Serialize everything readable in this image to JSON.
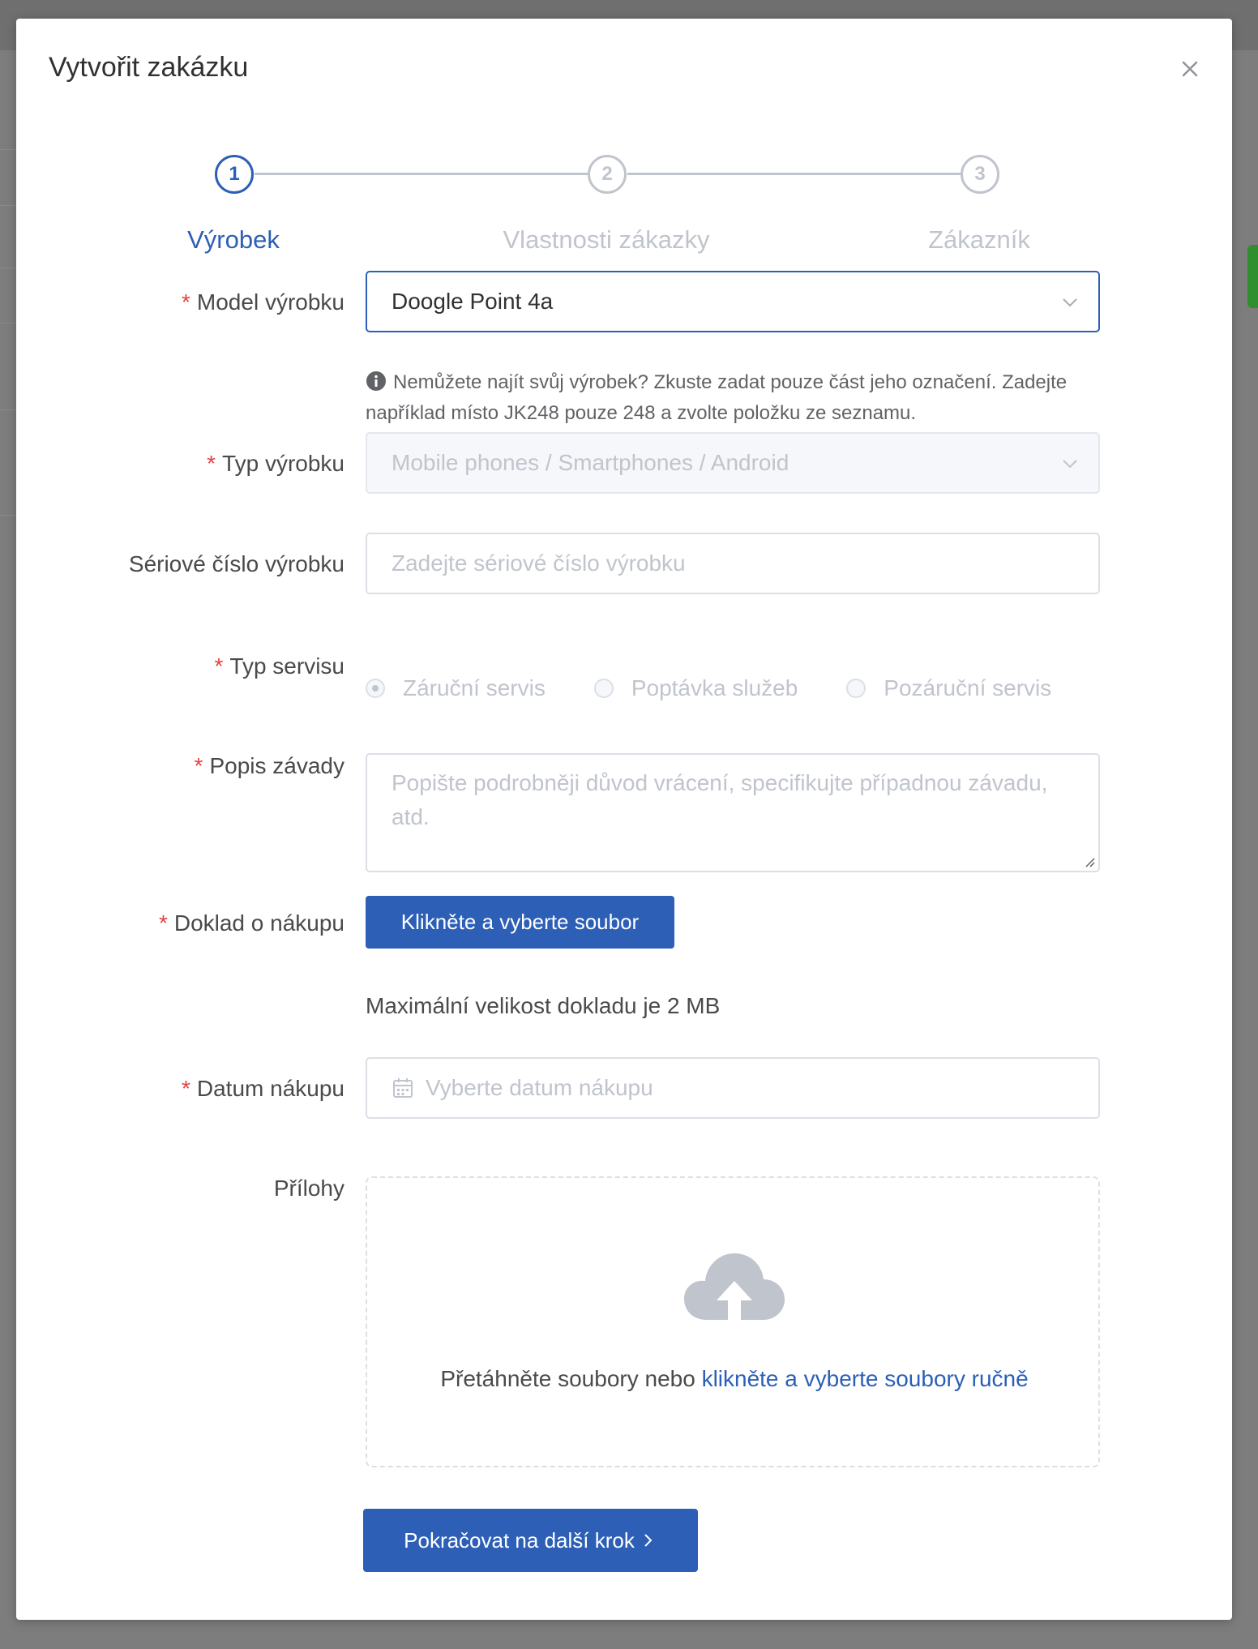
{
  "modal": {
    "title": "Vytvořit zakázku"
  },
  "steps": [
    {
      "number": "1",
      "label": "Výrobek"
    },
    {
      "number": "2",
      "label": "Vlastnosti zákazky"
    },
    {
      "number": "3",
      "label": "Zákazník"
    }
  ],
  "form": {
    "required_mark": "*",
    "model": {
      "label": "Model výrobku",
      "value": "Doogle Point 4a",
      "hint": "Nemůžete najít svůj výrobek? Zkuste zadat pouze část jeho označení. Zadejte například místo JK248 pouze 248 a zvolte položku ze seznamu."
    },
    "type": {
      "label": "Typ výrobku",
      "value": "Mobile phones / Smartphones / Android"
    },
    "serial": {
      "label": "Sériové číslo výrobku",
      "placeholder": "Zadejte sériové číslo výrobku"
    },
    "service": {
      "label": "Typ servisu",
      "options": [
        "Záruční servis",
        "Poptávka služeb",
        "Pozáruční servis"
      ],
      "selected": "Záruční servis"
    },
    "defect": {
      "label": "Popis závady",
      "placeholder": "Popište podrobněji důvod vrácení, specifikujte případnou závadu, atd."
    },
    "receipt": {
      "label": "Doklad o nákupu",
      "button": "Klikněte a vyberte soubor",
      "note": "Maximální velikost dokladu je 2 MB"
    },
    "date": {
      "label": "Datum nákupu",
      "placeholder": "Vyberte datum nákupu"
    },
    "attachments": {
      "label": "Přílohy",
      "drop_text": "Přetáhněte soubory nebo",
      "drop_link": "klikněte a vyberte soubory ručně"
    }
  },
  "footer": {
    "next_button": "Pokračovat na další krok",
    "next_icon": "chevron-right-icon"
  },
  "colors": {
    "primary": "#2c5fb5",
    "required": "#e84040",
    "disabled_text": "#c0c4cc",
    "overlay": "#7d7d7d"
  }
}
